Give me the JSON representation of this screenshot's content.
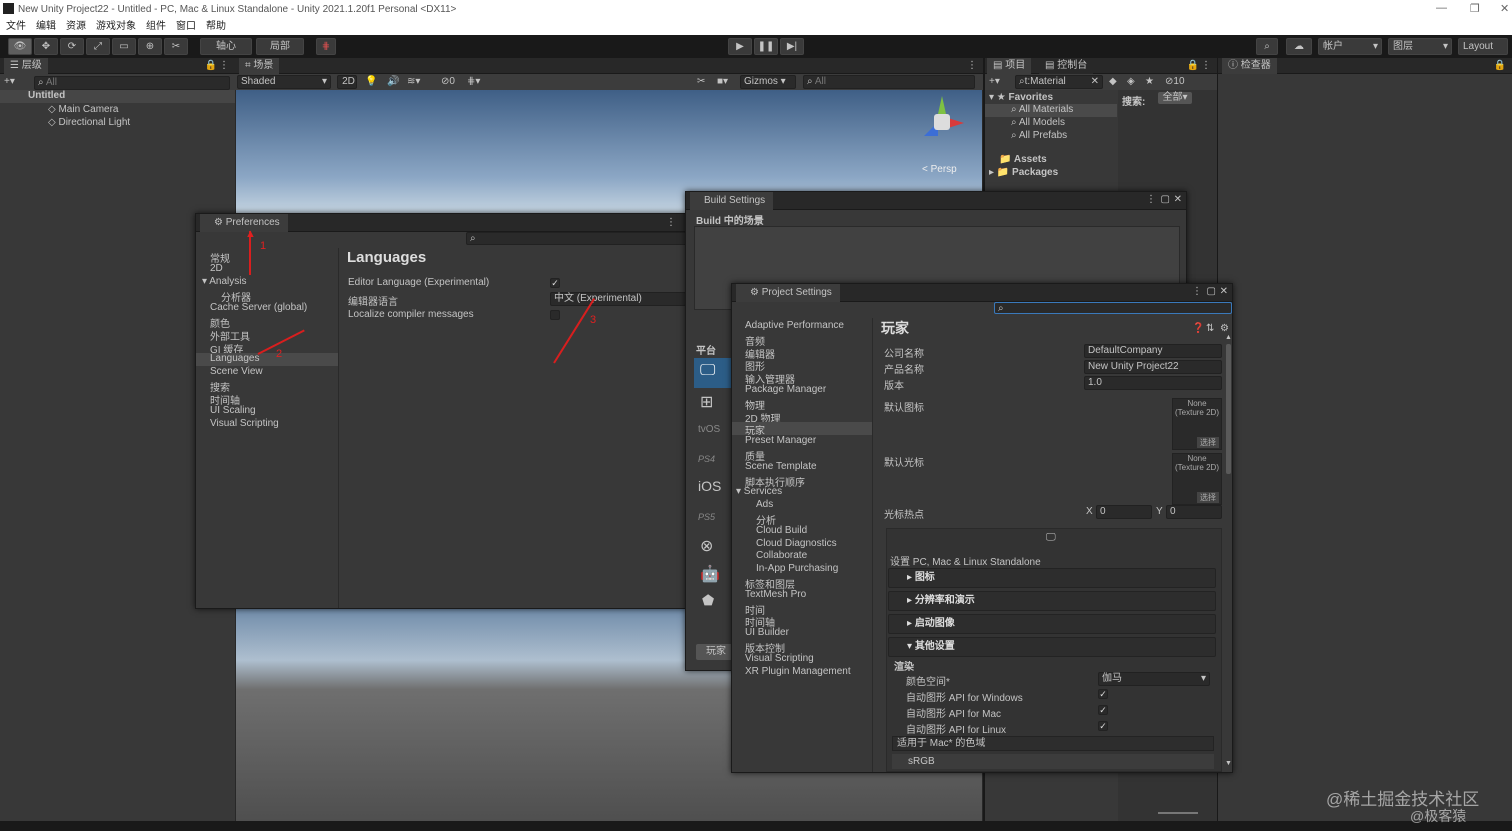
{
  "window": {
    "title": "New Unity Project22 - Untitled - PC, Mac & Linux Standalone - Unity 2021.1.20f1 Personal <DX11>"
  },
  "menu": [
    "文件",
    "编辑",
    "资源",
    "游戏对象",
    "组件",
    "窗口",
    "帮助"
  ],
  "toolbar": {
    "pivot": "轴心",
    "local": "局部",
    "account": "帐户",
    "layers": "图层",
    "layout": "Layout"
  },
  "hierarchy": {
    "tab": "层级",
    "search_placeholder": "All",
    "scene": "Untitled",
    "items": [
      "Main Camera",
      "Directional Light"
    ]
  },
  "scene_view": {
    "tab": "场景",
    "shading": "Shaded",
    "mode_2d": "2D",
    "layer_count": "0",
    "gizmos": "Gizmos",
    "search_placeholder": "All",
    "persp": "< Persp"
  },
  "project": {
    "tab": "项目",
    "console_tab": "控制台",
    "search_value": "t:Material",
    "count": "10",
    "favorites": "Favorites",
    "fav_items": [
      "All Materials",
      "All Models",
      "All Prefabs"
    ],
    "assets": "Assets",
    "packages": "Packages",
    "search_label": "搜索:",
    "search_scope": "全部"
  },
  "inspector": {
    "tab": "检查器"
  },
  "preferences": {
    "title": "Preferences",
    "nav": [
      "常规",
      "2D",
      "Analysis",
      "分析器",
      "Cache Server (global)",
      "颜色",
      "外部工具",
      "GI 缓存",
      "Languages",
      "Scene View",
      "搜索",
      "时间轴",
      "UI Scaling",
      "Visual Scripting"
    ],
    "heading": "Languages",
    "rows": [
      {
        "label": "Editor Language (Experimental)",
        "value": "",
        "checked": true
      },
      {
        "label": "编辑器语言",
        "value": "中文 (Experimental)"
      },
      {
        "label": "Localize compiler messages",
        "checked": false
      }
    ],
    "annotations": [
      "1",
      "2",
      "3"
    ]
  },
  "build_settings": {
    "title": "Build Settings",
    "scenes_label": "Build 中的场景",
    "platform_label": "平台",
    "play_btn": "玩家"
  },
  "project_settings": {
    "title": "Project Settings",
    "nav": [
      "Adaptive Performance",
      "音频",
      "编辑器",
      "图形",
      "输入管理器",
      "Package Manager",
      "物理",
      "2D 物理",
      "玩家",
      "Preset Manager",
      "质量",
      "Scene Template",
      "脚本执行顺序",
      "Services",
      "Ads",
      "分析",
      "Cloud Build",
      "Cloud Diagnostics",
      "Collaborate",
      "In-App Purchasing",
      "标签和图层",
      "TextMesh Pro",
      "时间",
      "时间轴",
      "UI Builder",
      "版本控制",
      "Visual Scripting",
      "XR Plugin Management"
    ],
    "heading": "玩家",
    "company_label": "公司名称",
    "company_value": "DefaultCompany",
    "product_label": "产品名称",
    "product_value": "New Unity Project22",
    "version_label": "版本",
    "version_value": "1.0",
    "default_icon_label": "默认图标",
    "default_cursor_label": "默认光标",
    "texture_none": "None",
    "texture_type": "(Texture 2D)",
    "select": "选择",
    "hotspot_label": "光标热点",
    "hotspot_x_label": "X",
    "hotspot_x": "0",
    "hotspot_y_label": "Y",
    "hotspot_y": "0",
    "platform_settings": "设置 PC, Mac & Linux Standalone",
    "sections": [
      "图标",
      "分辨率和演示",
      "启动图像",
      "其他设置"
    ],
    "render_label": "渲染",
    "color_space_label": "颜色空间*",
    "color_space_value": "伽马",
    "auto_api_windows": "自动图形 API  for Windows",
    "auto_api_mac": "自动图形 API  for Mac",
    "auto_api_linux": "自动图形 API  for Linux",
    "mac_gamut_label": "适用于 Mac* 的色域",
    "gamut_value": "sRGB"
  },
  "watermark": {
    "line1": "@稀土掘金技术社区",
    "line2": "@极客猿"
  },
  "colors": {
    "accent": "#2c5d87",
    "annotation": "#d81e1e"
  }
}
